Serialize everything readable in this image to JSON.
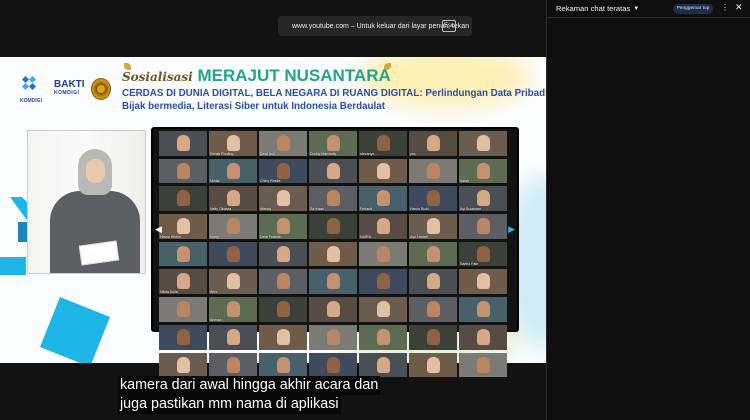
{
  "fullscreen_notice": {
    "text": "www.youtube.com – Untuk keluar dari layar penuh, tekan",
    "key": "Esc"
  },
  "slide": {
    "logos": {
      "komdigi": "KOMDIGI",
      "bakti": "BAKTI",
      "bakti_sub": "KOMDIGI"
    },
    "title_script": "Sosialisasi",
    "title_main": "MERAJUT NUSANTARA",
    "subtitle_line1": "CERDAS DI DUNIA DIGITAL, BELA NEGARA DI RUANG DIGITAL: Perlindungan Data Pribadi,",
    "subtitle_line2": "Bijak bermedia, Literasi Siber untuk Indonesia Berdaulat"
  },
  "participants": [
    "",
    "Rensti Ponting",
    "Dewi Asti",
    "Doddy Marhadiy",
    "stevanye...",
    "yos",
    "",
    "",
    "Nurlia",
    "Chiny Rosita",
    "",
    "",
    "",
    "Ifarah",
    "",
    "Nelly Oktavia",
    "Wendy",
    "Sa Irwan",
    "Feriardi",
    "Harun Rizki",
    "Ayi Sulaiman",
    "Haura Hilmin",
    "Vinny",
    "Dewi Fratirah",
    "",
    "NAIRIL",
    "Ayu Lestari",
    "",
    "",
    "",
    "",
    "",
    "",
    "",
    "Saeful Fatir",
    "Nikita Aulia",
    "Wira",
    "",
    "",
    "",
    "",
    "",
    "",
    "Ahmad",
    "",
    "",
    "",
    "",
    "",
    "",
    "",
    "",
    "",
    "",
    "",
    "",
    "",
    "",
    "",
    "",
    "",
    "",
    "",
    "",
    ""
  ],
  "caption": {
    "line1": "kamera dari awal hingga akhir acara dan",
    "line2": "juga pastikan mm nama di aplikasi"
  },
  "chat": {
    "header": "Rekaman chat teratas",
    "badge": "Penggemar top",
    "more": "⋮",
    "close": "✕"
  },
  "colors": {
    "title_green": "#1fa58b",
    "subtitle_blue": "#2a4fa5",
    "accent_blue": "#1fb5e6"
  }
}
